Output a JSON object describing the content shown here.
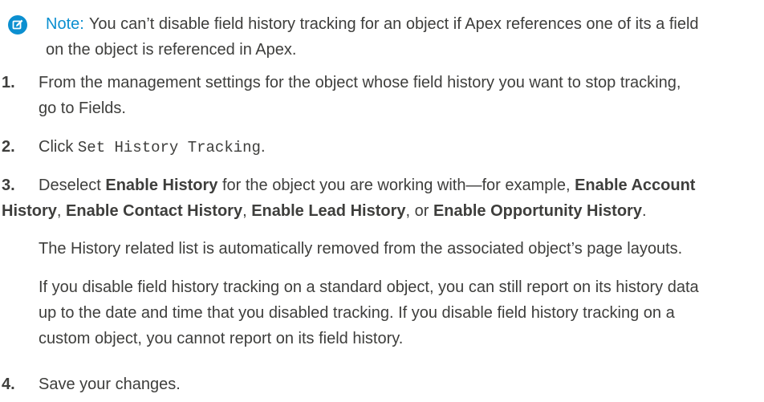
{
  "note": {
    "icon": "edit-note-icon",
    "label": "Note:",
    "line1": "You can’t disable field history tracking for an object if Apex references one of its a field",
    "line2": "on the object is referenced in Apex."
  },
  "steps": [
    {
      "num": "1.",
      "line1": "From the management settings for the object whose field history you want to stop tracking,",
      "line2": "go to Fields."
    },
    {
      "num": "2.",
      "pre": "Click ",
      "code": "Set History Tracking",
      "post": "."
    },
    {
      "num": "3.",
      "l1_a": "Deselect ",
      "l1_b": "Enable History",
      "l1_c": " for the object you are working with—for example, ",
      "l1_d": "Enable Account",
      "l2_a": "History",
      "l2_b": ", ",
      "l2_c": "Enable Contact History",
      "l2_d": ", ",
      "l2_e": "Enable Lead History",
      "l2_f": ", or ",
      "l2_g": "Enable Opportunity History",
      "l2_h": ".",
      "para1": "The History related list is automatically removed from the associated object’s page layouts.",
      "para2_l1": "If you disable field history tracking on a standard object, you can still report on its history data",
      "para2_l2": "up to the date and time that you disabled tracking. If you disable field history tracking on a",
      "para2_l3": "custom object, you cannot report on its field history."
    },
    {
      "num": "4.",
      "text": "Save your changes."
    }
  ],
  "colors": {
    "accent": "#0b8fd0",
    "text": "#3e3e3c"
  }
}
